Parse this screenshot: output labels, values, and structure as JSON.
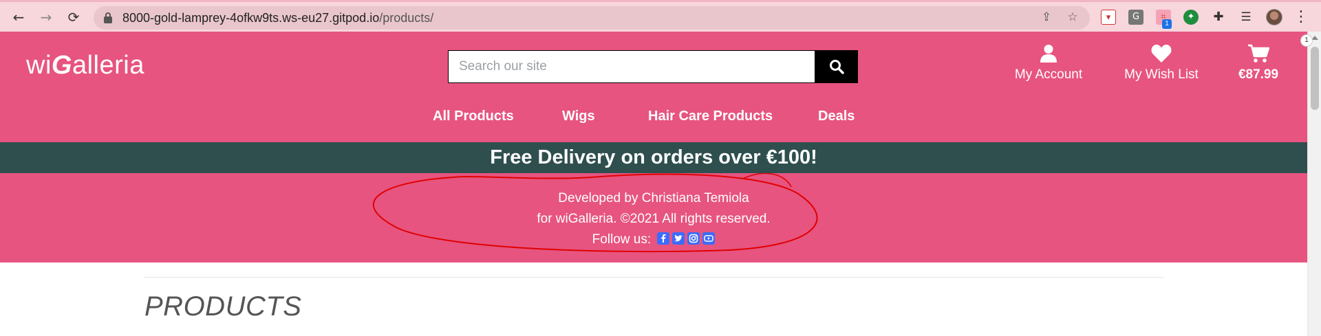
{
  "browser": {
    "url_host": "8000-gold-lamprey-4ofkw9ts.ws-eu27.gitpod.io",
    "url_path": "/products/",
    "extension_badge": "1",
    "notification_count": "1"
  },
  "site": {
    "logo": {
      "prefix": "wi",
      "g": "G",
      "suffix": "alleria"
    },
    "search": {
      "placeholder": "Search our site"
    },
    "account_label": "My Account",
    "wishlist_label": "My Wish List",
    "cart_total": "€87.99",
    "nav": [
      "All Products",
      "Wigs",
      "Hair Care Products",
      "Deals"
    ],
    "banner": "Free Delivery on orders over €100!",
    "developer": {
      "line1": "Developed by Christiana Temiola",
      "line2": "for wiGalleria. ©2021 All rights reserved.",
      "follow": "Follow us:",
      "social_icons": [
        "facebook-icon",
        "twitter-icon",
        "instagram-icon",
        "youtube-icon"
      ]
    },
    "page_title": "PRODUCTS"
  },
  "colors": {
    "brand_pink": "#e75480",
    "banner_bg": "#2f4f4f",
    "annotation_red": "#e00000",
    "social_blue": "#3b6cff"
  }
}
